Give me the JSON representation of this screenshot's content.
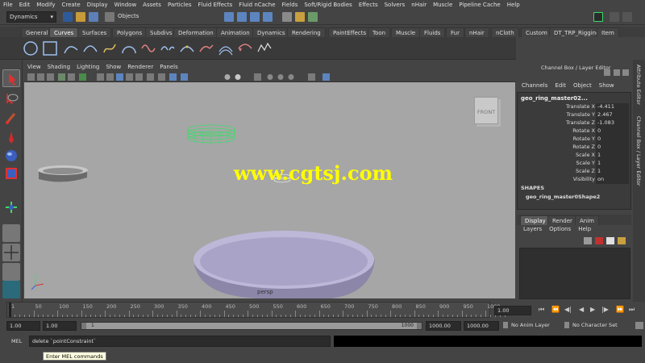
{
  "menubar": [
    "File",
    "Edit",
    "Modify",
    "Create",
    "Display",
    "Window",
    "Assets",
    "Particles",
    "Fluid Effects",
    "Fluid nCache",
    "Fields",
    "Soft/Rigid Bodies",
    "Effects",
    "Solvers",
    "nHair",
    "Muscle",
    "Pipeline Cache",
    "Help"
  ],
  "status": {
    "menu_set": "Dynamics",
    "objects_label": "Objects"
  },
  "shelf_tabs": [
    "General",
    "Curves",
    "Surfaces",
    "Polygons",
    "Subdivs",
    "Deformation",
    "Animation",
    "Dynamics",
    "Rendering",
    "PaintEffects",
    "Toon",
    "Muscle",
    "Fluids",
    "Fur",
    "nHair",
    "nCloth",
    "Custom",
    "DT_TRP_Rigging",
    "Item"
  ],
  "shelf_active_tab": "Curves",
  "viewport": {
    "menu": [
      "View",
      "Shading",
      "Lighting",
      "Show",
      "Renderer",
      "Panels"
    ],
    "view_cube_label": "FRONT",
    "camera_label": "persp",
    "watermark": "www.cgtsj.com"
  },
  "channel_box": {
    "header": "Channel Box / Layer Editor",
    "menu": [
      "Channels",
      "Edit",
      "Object",
      "Show"
    ],
    "object_name": "geo_ring_master02...",
    "attributes": [
      {
        "label": "Translate X",
        "value": "-4.411"
      },
      {
        "label": "Translate Y",
        "value": "2.467"
      },
      {
        "label": "Translate Z",
        "value": "-1.083"
      },
      {
        "label": "Rotate X",
        "value": "0"
      },
      {
        "label": "Rotate Y",
        "value": "0"
      },
      {
        "label": "Rotate Z",
        "value": "0"
      },
      {
        "label": "Scale X",
        "value": "1"
      },
      {
        "label": "Scale Y",
        "value": "1"
      },
      {
        "label": "Scale Z",
        "value": "1"
      },
      {
        "label": "Visibility",
        "value": "on"
      }
    ],
    "shapes_header": "SHAPES",
    "shape_name": "geo_ring_master0Shape2"
  },
  "side_tabs": [
    "Attribute Editor",
    "Channel Box / Layer Editor"
  ],
  "layer_editor": {
    "tabs": [
      "Display",
      "Render",
      "Anim"
    ],
    "active_tab": "Display",
    "menu": [
      "Layers",
      "Options",
      "Help"
    ]
  },
  "timeline": {
    "ticks": [
      "1",
      "50",
      "100",
      "150",
      "200",
      "250",
      "300",
      "350",
      "400",
      "450",
      "500",
      "550",
      "600",
      "650",
      "700",
      "750",
      "800",
      "850",
      "900",
      "950",
      "1000"
    ],
    "current_frame": "1.00"
  },
  "range": {
    "start_time": "1.00",
    "playback_start": "1.00",
    "range_start": "1",
    "range_end": "1000",
    "playback_end": "1000.00",
    "end_time": "1000.00",
    "anim_layer": "No Anim Layer",
    "character_set": "No Character Set"
  },
  "command_line": {
    "label": "MEL",
    "input": "delete `pointConstraint`",
    "tooltip": "Enter MEL commands"
  },
  "colors": {
    "viewport_bg": "#a6a6a6",
    "selected_wire": "#3cdc6a",
    "watermark": "#ffff00"
  }
}
